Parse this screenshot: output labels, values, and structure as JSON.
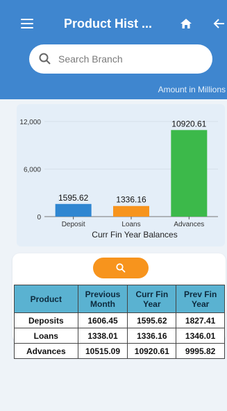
{
  "header": {
    "title": "Product Hist ...",
    "search_placeholder": "Search Branch",
    "amount_note": "Amount in Millions"
  },
  "chart_data": {
    "type": "bar",
    "categories": [
      "Deposit",
      "Loans",
      "Advances"
    ],
    "values": [
      1595.62,
      1336.16,
      10920.61
    ],
    "value_labels": [
      "1595.62",
      "1336.16",
      "10920.61"
    ],
    "colors": [
      "#2f86d1",
      "#f7941d",
      "#3cb94a"
    ],
    "yticks": [
      "12,000",
      "6,000",
      "0"
    ],
    "ylim": [
      0,
      12000
    ],
    "xlabel": "Curr Fin Year Balances"
  },
  "table": {
    "headers": [
      "Product",
      "Previous Month",
      "Curr Fin Year",
      "Prev Fin Year"
    ],
    "rows": [
      [
        "Deposits",
        "1606.45",
        "1595.62",
        "1827.41"
      ],
      [
        "Loans",
        "1338.01",
        "1336.16",
        "1346.01"
      ],
      [
        "Advances",
        "10515.09",
        "10920.61",
        "9995.82"
      ]
    ]
  }
}
